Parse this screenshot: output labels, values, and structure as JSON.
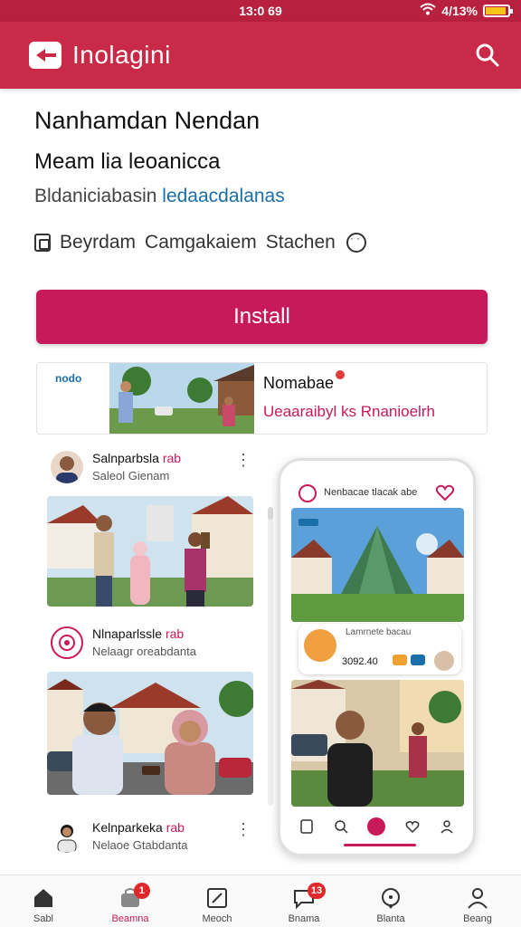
{
  "status_bar": {
    "time": "13:0 69",
    "battery": "4/13%",
    "battery_level": 0.9
  },
  "app_bar": {
    "title": "Inolagini",
    "logo_icon": "brand-logo-icon",
    "search_icon": "search-icon"
  },
  "app_info": {
    "name": "Nanhamdan Nendan",
    "subtitle": "Meam lia leoanicca",
    "developer_prefix": "Bldaniciabasin",
    "developer_link": "ledaacdalanas",
    "meta": [
      "Beyrdam",
      "Camgakaiem",
      "Stachen"
    ]
  },
  "install_button": {
    "label": "Install"
  },
  "banner": {
    "brand": "nodo",
    "title": "Nomabae",
    "text": "Ueaaraibyl ks Rnanioelrh"
  },
  "feed": [
    {
      "name": "Salnparbsla",
      "tag": "rab",
      "sub": "Saleol Gienam"
    },
    {
      "name": "Nlnaparlssle",
      "tag": "rab",
      "sub": "Nelaagr oreabdanta"
    },
    {
      "name": "Kelnparkeka",
      "tag": "rab",
      "sub": "Nelaoe Gtabdanta"
    }
  ],
  "phone_preview": {
    "title": "Nenbacae tlacak abe",
    "profile_name": "Lamrnete bacau",
    "stat": "3092.40",
    "chip_colors": [
      "#f0a030",
      "#1b6fa8"
    ]
  },
  "bottom_nav": [
    {
      "label": "Sabl",
      "icon": "home-icon",
      "active": false
    },
    {
      "label": "Beamna",
      "icon": "shop-icon",
      "active": true,
      "badge": "1"
    },
    {
      "label": "Meoch",
      "icon": "edit-icon",
      "active": false
    },
    {
      "label": "Bnama",
      "icon": "chat-icon",
      "active": false,
      "badge": "13"
    },
    {
      "label": "Blanta",
      "icon": "message-icon",
      "active": false
    },
    {
      "label": "Beang",
      "icon": "profile-icon",
      "active": false
    }
  ],
  "colors": {
    "primary": "#c8195a",
    "app_bar": "#c82a48",
    "link": "#1b6fa8"
  }
}
